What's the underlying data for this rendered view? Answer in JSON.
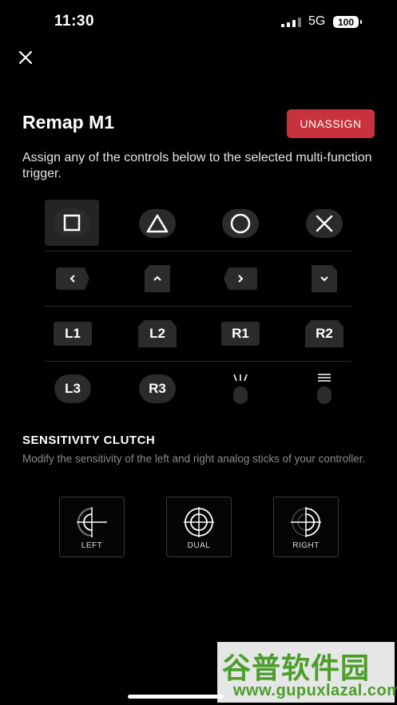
{
  "status_bar": {
    "time": "11:30",
    "network": "5G",
    "battery": "100"
  },
  "header": {
    "title": "Remap M1",
    "unassign_label": "UNASSIGN"
  },
  "description": "Assign any of the controls below to the selected multi-function trigger.",
  "controls": {
    "row1": [
      "square-icon",
      "triangle-icon",
      "circle-icon",
      "cross-icon"
    ],
    "row2": [
      "dpad-left-icon",
      "dpad-up-icon",
      "dpad-right-icon",
      "dpad-down-icon"
    ],
    "row3": [
      "L1",
      "L2",
      "R1",
      "R2"
    ],
    "row4": [
      "L3",
      "R3",
      "create-button-icon",
      "options-button-icon"
    ]
  },
  "sensitivity": {
    "title": "SENSITIVITY CLUTCH",
    "description": "Modify the sensitivity of the left and right analog sticks of your controller.",
    "options": [
      "LEFT",
      "DUAL",
      "RIGHT"
    ]
  },
  "watermark": {
    "text": "谷普软件园",
    "url": "www.gupuxlazal.com"
  },
  "colors": {
    "accent": "#c8323c",
    "background": "#000000",
    "button": "#2b2b2b"
  }
}
